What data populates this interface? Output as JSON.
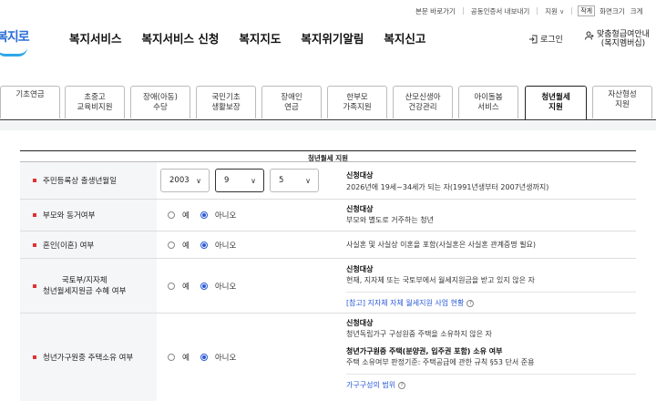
{
  "util_bar": {
    "skip_link": "본문 바로가기",
    "cert_link": "공동인증서 내보내기",
    "support": "지원",
    "font_small": "작게",
    "font_size": "화면크기",
    "font_large": "크게"
  },
  "header": {
    "logo_text": "복지로",
    "nav": [
      "복지서비스",
      "복지서비스 신청",
      "복지지도",
      "복지위기알림",
      "복지신고"
    ],
    "login": "로그인",
    "custom_line1": "맞춤형급여안내",
    "custom_line2": "(복지멤버십)"
  },
  "tabs": [
    {
      "l1": "기초연금",
      "l2": ""
    },
    {
      "l1": "초중고",
      "l2": "교육비지원"
    },
    {
      "l1": "장애(아동)",
      "l2": "수당"
    },
    {
      "l1": "국민기초",
      "l2": "생활보장"
    },
    {
      "l1": "장애인",
      "l2": "연금"
    },
    {
      "l1": "한부모",
      "l2": "가족지원"
    },
    {
      "l1": "산모신생아",
      "l2": "건강관리"
    },
    {
      "l1": "아이돌봄",
      "l2": "서비스"
    },
    {
      "l1": "청년월세",
      "l2": "지원"
    },
    {
      "l1": "자산형성",
      "l2": "지원"
    }
  ],
  "table": {
    "title": "청년월세 지원",
    "rows": {
      "birth": {
        "label": "주민등록상 출생년월일",
        "year": "2003",
        "month": "9",
        "day": "5",
        "desc_h": "신청대상",
        "desc_p": "2026년에 19세~34세가 되는 자(1991년생부터 2007년생까지)"
      },
      "parents": {
        "label": "부모와 동거여부",
        "yes": "예",
        "no": "아니오",
        "desc_h": "신청대상",
        "desc_p": "부모와 별도로 거주하는 청년"
      },
      "marriage": {
        "label": "혼인(이혼) 여부",
        "yes": "예",
        "no": "아니오",
        "desc_p": "사실혼 및 사실상 이혼을 포함(사실혼은 사실혼 관계증명 필요)"
      },
      "support": {
        "label1": "국토부/지자체",
        "label2": "청년월세지원금 수혜 여부",
        "yes": "예",
        "no": "아니오",
        "desc_h": "신청대상",
        "desc_p": "현재, 지자체 또는 국토부에서 월세지원금을 받고 있지 않은 자",
        "link": "[참고] 지자체 자체 월세지원 사업 현황"
      },
      "housing": {
        "label": "청년가구원중 주택소유 여부",
        "yes": "예",
        "no": "아니오",
        "desc_h": "신청대상",
        "desc_p": "청년독립가구 구성원중 주택을 소유하지 않은 자",
        "desc_h2": "청년가구원중 주택(분양권, 입주권 포함) 소유 여부",
        "desc_p2": "주택 소유여부 판정기준: 주택공급에 관한 규칙 §53 단서 준용",
        "link": "가구구성의 범위"
      }
    }
  }
}
